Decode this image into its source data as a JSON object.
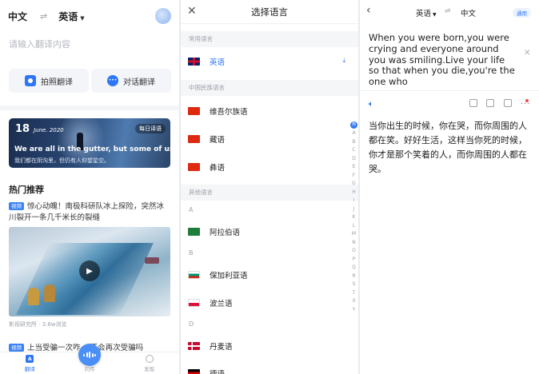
{
  "home": {
    "source_lang": "中文",
    "swap_icon": "swap-icon",
    "target_lang": "英语",
    "input_placeholder": "请输入翻译内容",
    "photo_translate": "拍照翻译",
    "dialog_translate": "对话翻译",
    "daily": {
      "day": "18",
      "month_year": "June. 2020",
      "tag": "每日译语",
      "en": "We are all in the gutter, but some of us...",
      "cn": "我们都在阴沟里，但仍有人仰望星空。"
    },
    "hot_title": "热门推荐",
    "news": [
      {
        "badge": "视频",
        "title": "惊心动魄！南极科研队冰上探险，突然冰川裂开一条几千米长的裂缝"
      },
      {
        "badge": "视频",
        "title": "上当受骗一次咋... 还会再次受骗吗"
      }
    ],
    "news_meta": "影视研究所 · 3.6w浏览",
    "tabs": [
      "翻译",
      "同传",
      "发现"
    ]
  },
  "picker": {
    "title": "选择语言",
    "sections": {
      "common": "常用语言",
      "ethnic": "中国民族语言",
      "other": "其他语言"
    },
    "common_items": [
      {
        "label": "英语",
        "flag": "uk"
      }
    ],
    "ethnic_items": [
      {
        "label": "维吾尔族语",
        "flag": "cn"
      },
      {
        "label": "藏语",
        "flag": "cn"
      },
      {
        "label": "彝语",
        "flag": "cn"
      }
    ],
    "letters": [
      "A",
      "B",
      "D"
    ],
    "other_items": [
      {
        "label": "阿拉伯语",
        "flag": "ar"
      },
      {
        "label": "保加利亚语",
        "flag": "bg"
      },
      {
        "label": "波兰语",
        "flag": "pl"
      },
      {
        "label": "丹麦语",
        "flag": "dk"
      },
      {
        "label": "德语",
        "flag": "de"
      }
    ],
    "index": [
      "A",
      "B",
      "C",
      "D",
      "E",
      "F",
      "G",
      "H",
      "I",
      "J",
      "K",
      "L",
      "M",
      "N",
      "O",
      "P",
      "Q",
      "R",
      "S",
      "T",
      "X",
      "Y"
    ]
  },
  "result": {
    "source_lang": "英语",
    "target_lang": "中文",
    "chip": "通用",
    "source_text": "When you were born,you were crying and everyone around you was smiling.Live your life so that when you die,you're the one who",
    "translation": "当你出生的时候，你在哭，而你周围的人都在笑。好好生活，这样当你死的时候，你才是那个笑着的人，而你周围的人都在哭。"
  },
  "colors": {
    "accent": "#2f76f6",
    "card_bg": "#1b2d4f"
  }
}
